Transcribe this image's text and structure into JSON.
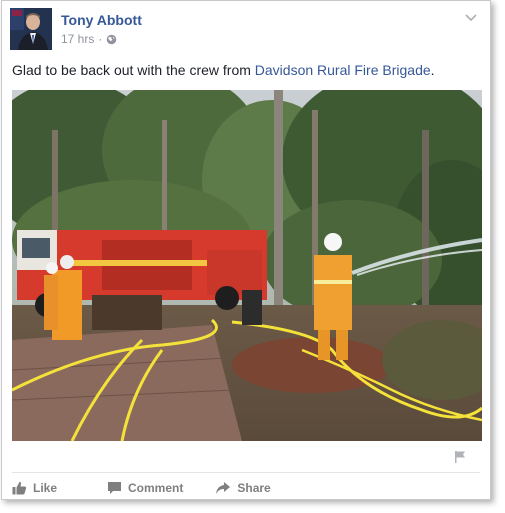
{
  "post": {
    "author": "Tony Abbott",
    "time": "17 hrs",
    "separator": "·",
    "text_before": "Glad to be back out with the crew from ",
    "link_text": "Davidson Rural Fire Brigade",
    "text_after": "."
  },
  "icons": {
    "privacy": "globe-icon",
    "options": "chevron-down-icon",
    "report": "flag-icon",
    "like": "thumbs-up-icon",
    "comment": "speech-bubble-icon",
    "share": "share-arrow-icon"
  },
  "actions": {
    "like_label": "Like",
    "comment_label": "Comment",
    "share_label": "Share"
  },
  "colors": {
    "link": "#365899",
    "meta": "#90949c",
    "action": "#7f7f7f"
  }
}
